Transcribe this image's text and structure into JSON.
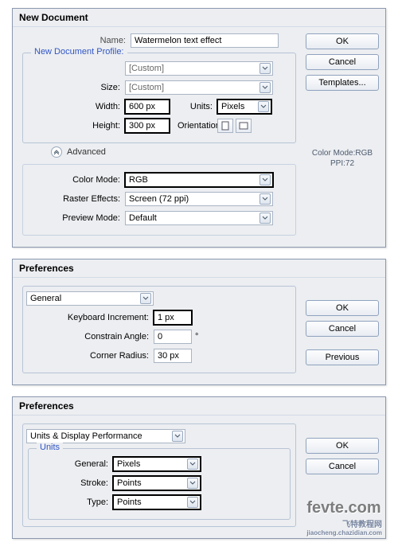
{
  "newdoc": {
    "title": "New Document",
    "labels": {
      "name": "Name:",
      "profile": "New Document Profile:",
      "size": "Size:",
      "width": "Width:",
      "height": "Height:",
      "units": "Units:",
      "orientation": "Orientation:",
      "advanced": "Advanced",
      "colormode": "Color Mode:",
      "raster": "Raster Effects:",
      "preview": "Preview Mode:"
    },
    "values": {
      "name": "Watermelon text effect",
      "profile": "[Custom]",
      "size": "[Custom]",
      "width": "600 px",
      "height": "300 px",
      "units": "Pixels",
      "colormode": "RGB",
      "raster": "Screen (72 ppi)",
      "preview": "Default"
    },
    "buttons": {
      "ok": "OK",
      "cancel": "Cancel",
      "templates": "Templates..."
    },
    "info1": "Color Mode:RGB",
    "info2": "PPI:72"
  },
  "prefs1": {
    "title": "Preferences",
    "section": "General",
    "labels": {
      "keyinc": "Keyboard Increment:",
      "constrain": "Constrain Angle:",
      "corner": "Corner Radius:"
    },
    "values": {
      "keyinc": "1 px",
      "constrain": "0",
      "corner": "30 px",
      "deg": "°"
    },
    "buttons": {
      "ok": "OK",
      "cancel": "Cancel",
      "previous": "Previous"
    }
  },
  "prefs2": {
    "title": "Preferences",
    "section": "Units & Display Performance",
    "unitsLegend": "Units",
    "labels": {
      "general": "General:",
      "stroke": "Stroke:",
      "type": "Type:"
    },
    "values": {
      "general": "Pixels",
      "stroke": "Points",
      "type": "Points"
    },
    "buttons": {
      "ok": "OK",
      "cancel": "Cancel"
    }
  },
  "watermark": {
    "logo": "fevte.com",
    "sub1": "飞特教程网",
    "sub2": "jiaocheng.chazidian.com"
  }
}
